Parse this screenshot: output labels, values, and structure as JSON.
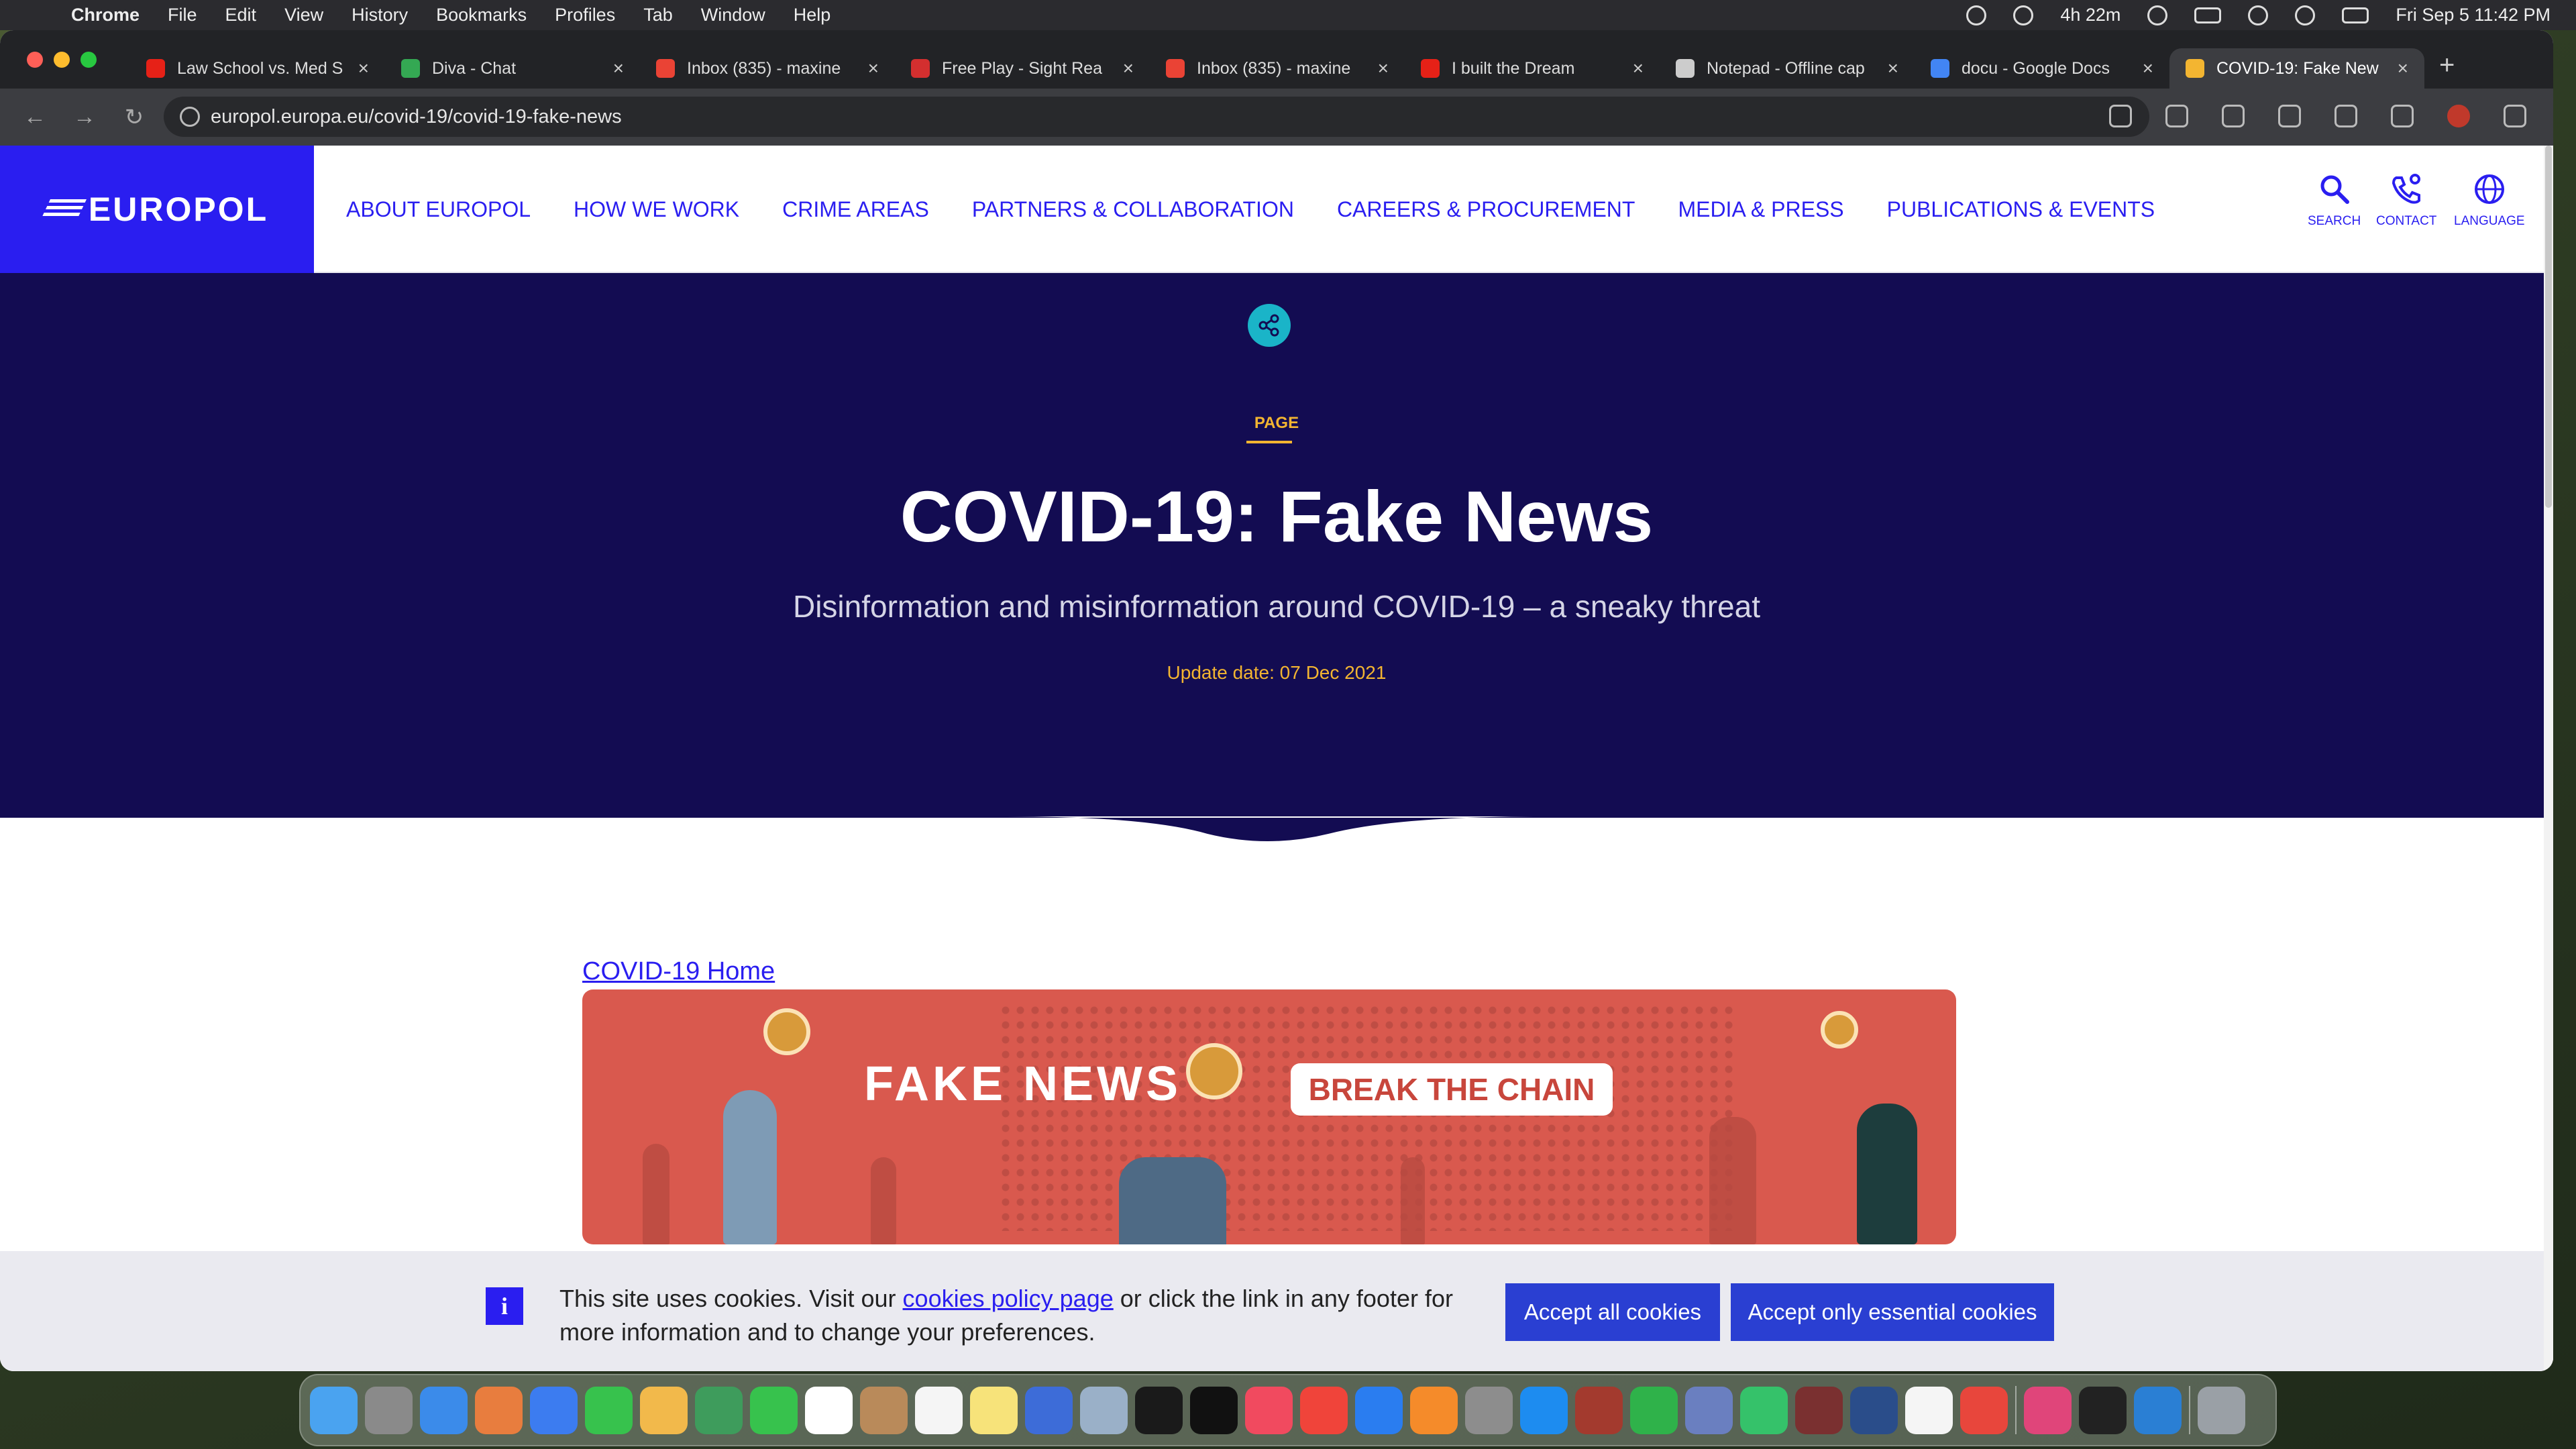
{
  "menubar": {
    "app": "Chrome",
    "items": [
      "File",
      "Edit",
      "View",
      "History",
      "Bookmarks",
      "Profiles",
      "Tab",
      "Window",
      "Help"
    ],
    "battery_time": "4h 22m",
    "clock": "Fri Sep 5  11:42 PM"
  },
  "tabs": [
    {
      "title": "Law School vs. Med S",
      "favicon_color": "#e62117"
    },
    {
      "title": "Diva - Chat",
      "favicon_color": "#34a853"
    },
    {
      "title": "Inbox (835) - maxine",
      "favicon_color": "#ea4335"
    },
    {
      "title": "Free Play - Sight Rea",
      "favicon_color": "#d32f2f"
    },
    {
      "title": "Inbox (835) - maxine",
      "favicon_color": "#ea4335"
    },
    {
      "title": "I built the Dream",
      "favicon_color": "#e62117"
    },
    {
      "title": "Notepad - Offline cap",
      "favicon_color": "#cccccc"
    },
    {
      "title": "docu - Google Docs",
      "favicon_color": "#4285f4"
    },
    {
      "title": "COVID-19: Fake New",
      "favicon_color": "#f3b531"
    }
  ],
  "address": {
    "url": "europol.europa.eu/covid-19/covid-19-fake-news"
  },
  "site": {
    "logo": "EUROPOL",
    "nav": [
      "ABOUT EUROPOL",
      "HOW WE WORK",
      "CRIME AREAS",
      "PARTNERS & COLLABORATION",
      "CAREERS & PROCUREMENT",
      "MEDIA & PRESS",
      "PUBLICATIONS & EVENTS"
    ],
    "utility": {
      "search": "SEARCH",
      "contact": "CONTACT",
      "language": "LANGUAGE"
    }
  },
  "hero": {
    "kicker": "PAGE",
    "title": "COVID-19: Fake News",
    "subtitle": "Disinformation and misinformation around COVID-19 – a sneaky threat",
    "update": "Update date: 07 Dec 2021"
  },
  "content": {
    "breadcrumb": "COVID-19 Home",
    "banner_left": "FAKE NEWS",
    "banner_right": "BREAK THE CHAIN"
  },
  "cookie": {
    "text_before": "This site uses cookies. Visit our ",
    "link": "cookies policy page",
    "text_after": " or click the link in any footer for more information and to change your preferences.",
    "accept_all": "Accept all cookies",
    "accept_essential": "Accept only essential cookies"
  },
  "colors": {
    "brand_blue": "#2a1ef0",
    "hero_navy": "#130c52",
    "accent_gold": "#f3b531",
    "banner_red": "#d9594e"
  },
  "dock_apps": [
    "finder",
    "launchpad",
    "safari",
    "apps",
    "mail",
    "messages",
    "photos",
    "maps",
    "facetime",
    "calendar",
    "contacts",
    "reminders",
    "notes",
    "freeform",
    "preview",
    "pycharm",
    "tv",
    "music",
    "news",
    "keynote",
    "pages",
    "settings",
    "app-store",
    "dictionary",
    "numbers",
    "notability",
    "find-my",
    "photo-booth",
    "quicktime",
    "clock",
    "chrome",
    "slack",
    "terminal",
    "vscode",
    "trash"
  ]
}
